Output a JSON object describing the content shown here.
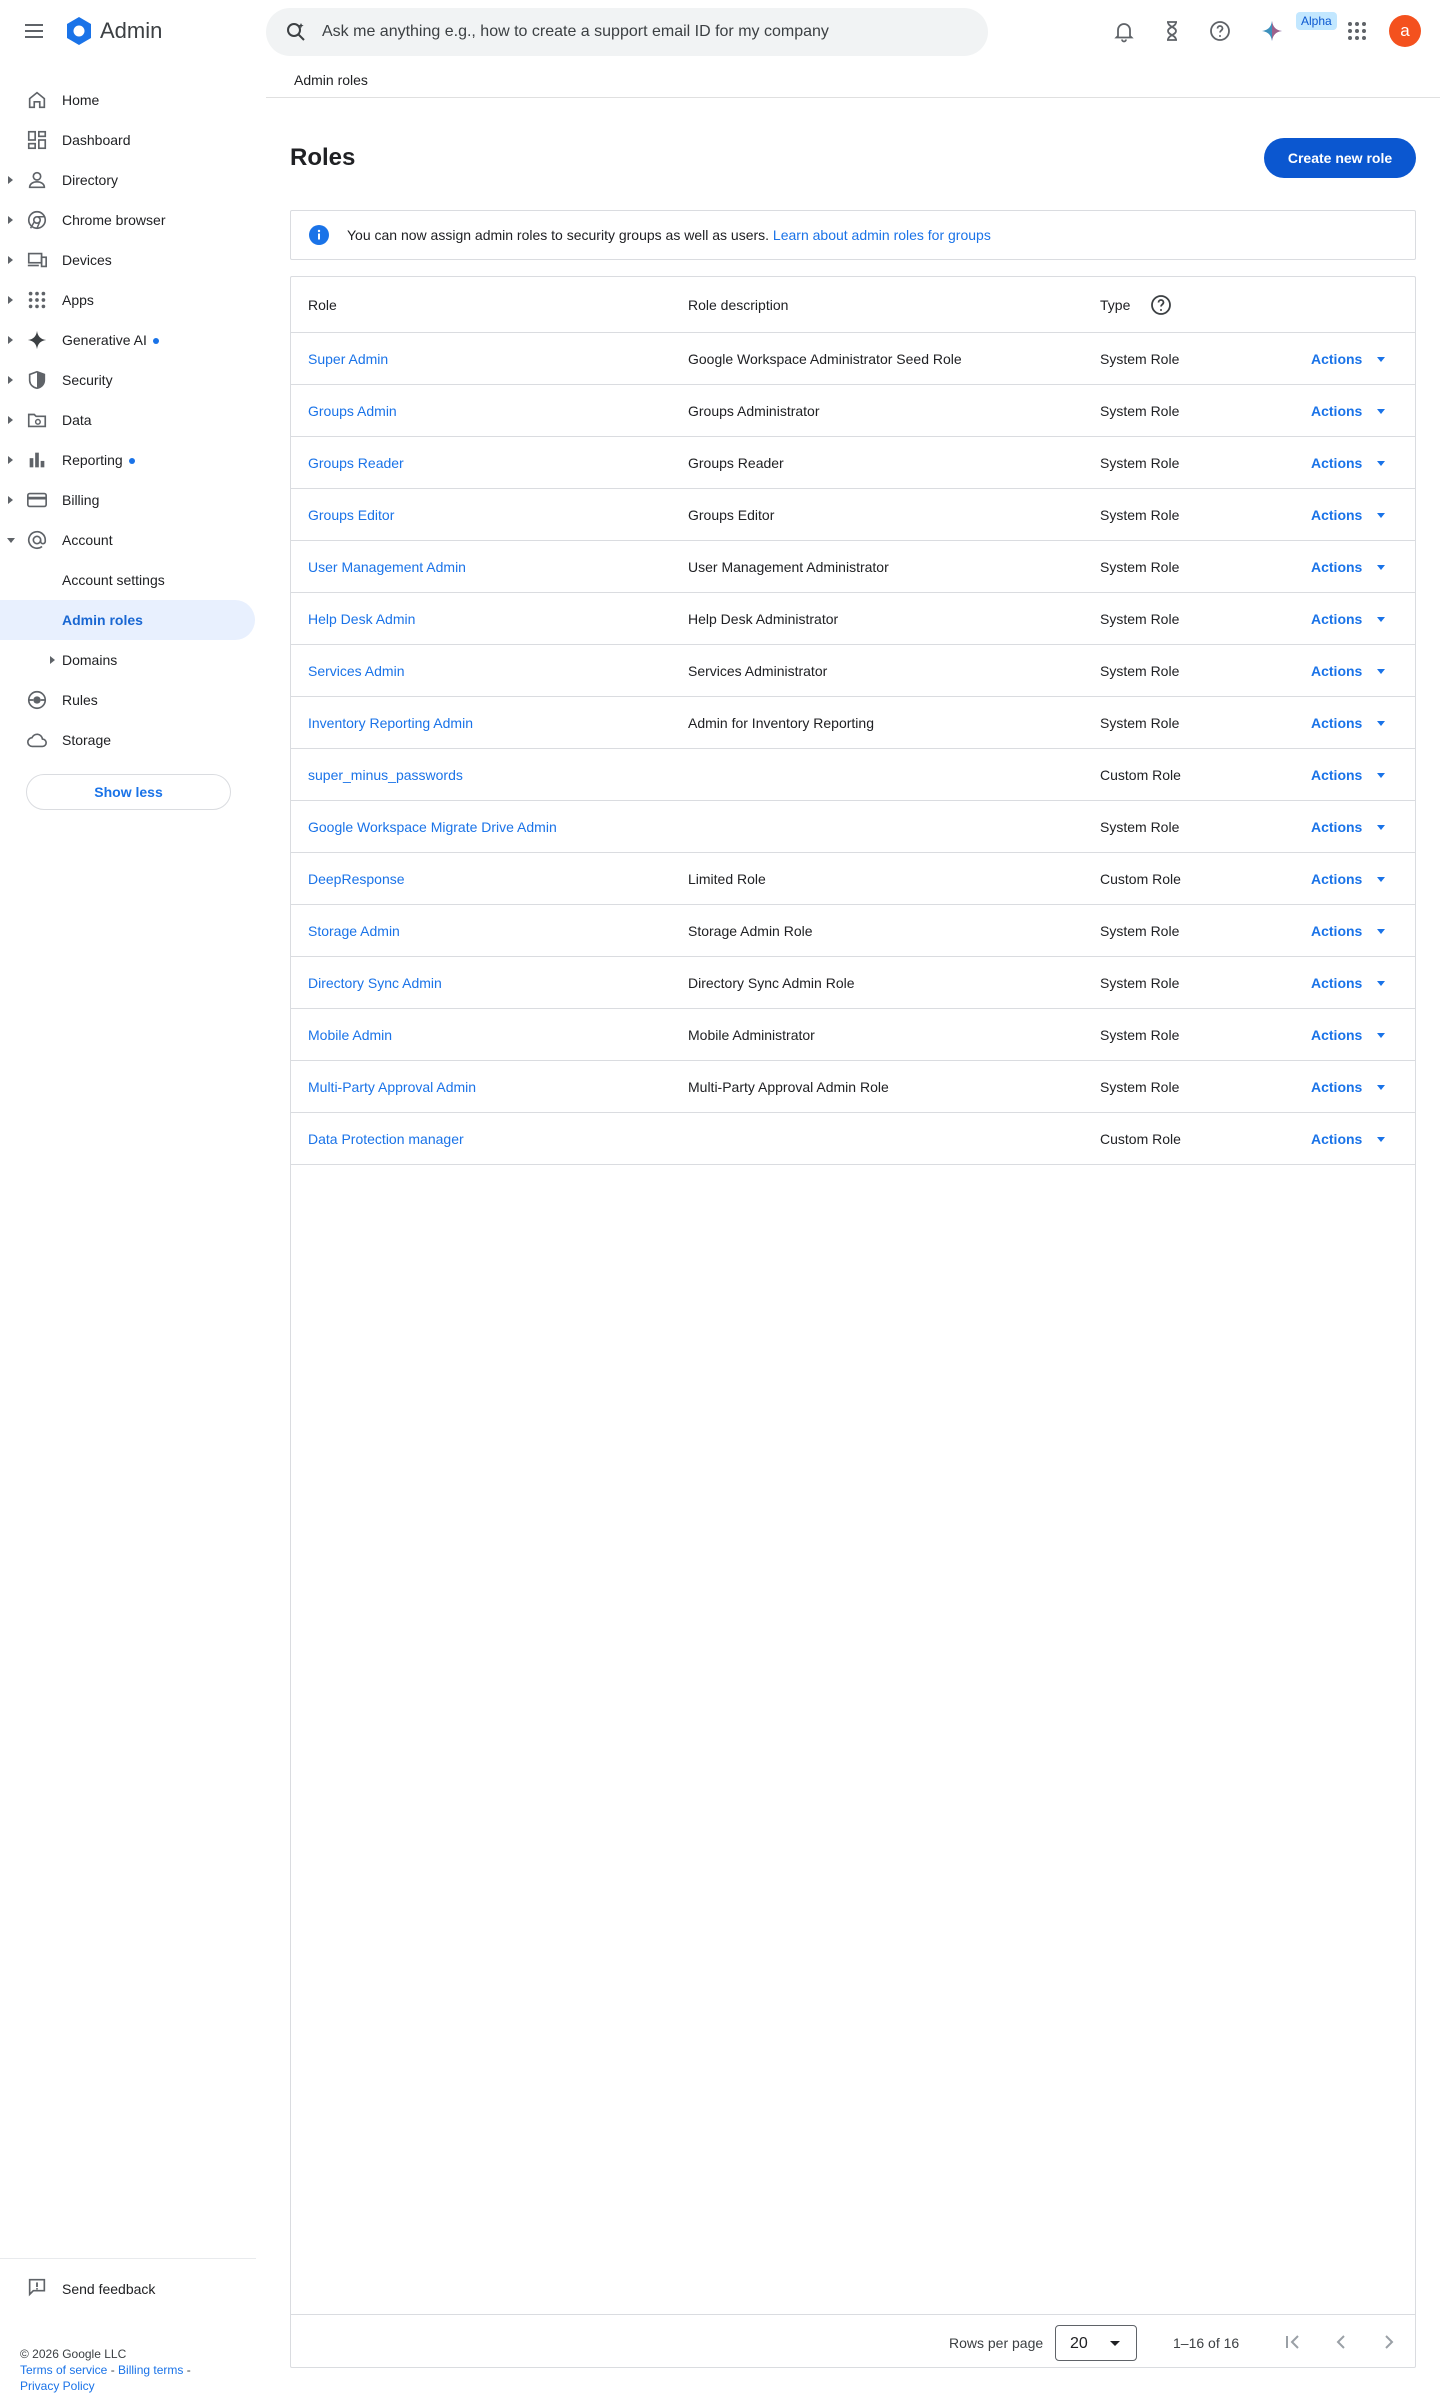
{
  "app": {
    "title": "Admin"
  },
  "search": {
    "placeholder": "Ask me anything e.g., how to create a support email ID for my company"
  },
  "topbar": {
    "alpha_label": "Alpha",
    "avatar_letter": "a"
  },
  "sidebar": {
    "items": [
      {
        "label": "Home",
        "icon": "home-icon"
      },
      {
        "label": "Dashboard",
        "icon": "dashboard-icon"
      },
      {
        "label": "Directory",
        "icon": "person-icon"
      },
      {
        "label": "Chrome browser",
        "icon": "chrome-icon"
      },
      {
        "label": "Devices",
        "icon": "devices-icon"
      },
      {
        "label": "Apps",
        "icon": "apps-grid-icon"
      },
      {
        "label": "Generative AI",
        "icon": "sparkle-icon"
      },
      {
        "label": "Security",
        "icon": "shield-icon"
      },
      {
        "label": "Data",
        "icon": "folder-icon"
      },
      {
        "label": "Reporting",
        "icon": "bar-chart-icon"
      },
      {
        "label": "Billing",
        "icon": "credit-card-icon"
      },
      {
        "label": "Account",
        "icon": "at-sign-icon"
      },
      {
        "label": "Rules",
        "icon": "rules-icon"
      },
      {
        "label": "Storage",
        "icon": "cloud-icon"
      }
    ],
    "account_sub": [
      {
        "label": "Account settings"
      },
      {
        "label": "Admin roles"
      },
      {
        "label": "Domains"
      }
    ],
    "show_less": "Show less",
    "send_feedback": "Send feedback"
  },
  "footer": {
    "copyright": "© 2026 Google LLC",
    "terms": "Terms of service",
    "billing_terms": "Billing terms",
    "privacy": "Privacy Policy"
  },
  "breadcrumb": "Admin roles",
  "page": {
    "title": "Roles",
    "create_button": "Create new role"
  },
  "info_banner": {
    "text": "You can now assign admin roles to security groups as well as users.",
    "link": "Learn about admin roles for groups"
  },
  "table": {
    "headers": {
      "role": "Role",
      "description": "Role description",
      "type": "Type"
    },
    "actions_label": "Actions",
    "rows": [
      {
        "role": "Super Admin",
        "description": "Google Workspace Administrator Seed Role",
        "type": "System Role"
      },
      {
        "role": "Groups Admin",
        "description": "Groups Administrator",
        "type": "System Role"
      },
      {
        "role": "Groups Reader",
        "description": "Groups Reader",
        "type": "System Role"
      },
      {
        "role": "Groups Editor",
        "description": "Groups Editor",
        "type": "System Role"
      },
      {
        "role": "User Management Admin",
        "description": "User Management Administrator",
        "type": "System Role"
      },
      {
        "role": "Help Desk Admin",
        "description": "Help Desk Administrator",
        "type": "System Role"
      },
      {
        "role": "Services Admin",
        "description": "Services Administrator",
        "type": "System Role"
      },
      {
        "role": "Inventory Reporting Admin",
        "description": "Admin for Inventory Reporting",
        "type": "System Role"
      },
      {
        "role": "super_minus_passwords",
        "description": "",
        "type": "Custom Role"
      },
      {
        "role": "Google Workspace Migrate Drive Admin",
        "description": "",
        "type": "System Role"
      },
      {
        "role": "DeepResponse",
        "description": "Limited Role",
        "type": "Custom Role"
      },
      {
        "role": "Storage Admin",
        "description": "Storage Admin Role",
        "type": "System Role"
      },
      {
        "role": "Directory Sync Admin",
        "description": "Directory Sync Admin Role",
        "type": "System Role"
      },
      {
        "role": "Mobile Admin",
        "description": "Mobile Administrator",
        "type": "System Role"
      },
      {
        "role": "Multi-Party Approval Admin",
        "description": "Multi-Party Approval Admin Role",
        "type": "System Role"
      },
      {
        "role": "Data Protection manager",
        "description": "",
        "type": "Custom Role"
      }
    ]
  },
  "pagination": {
    "rows_per_page_label": "Rows per page",
    "rows_per_page": "20",
    "range": "1–16 of 16"
  },
  "colors": {
    "accent": "#0b57d0",
    "link": "#1a73e8",
    "avatar": "#f4511e"
  }
}
